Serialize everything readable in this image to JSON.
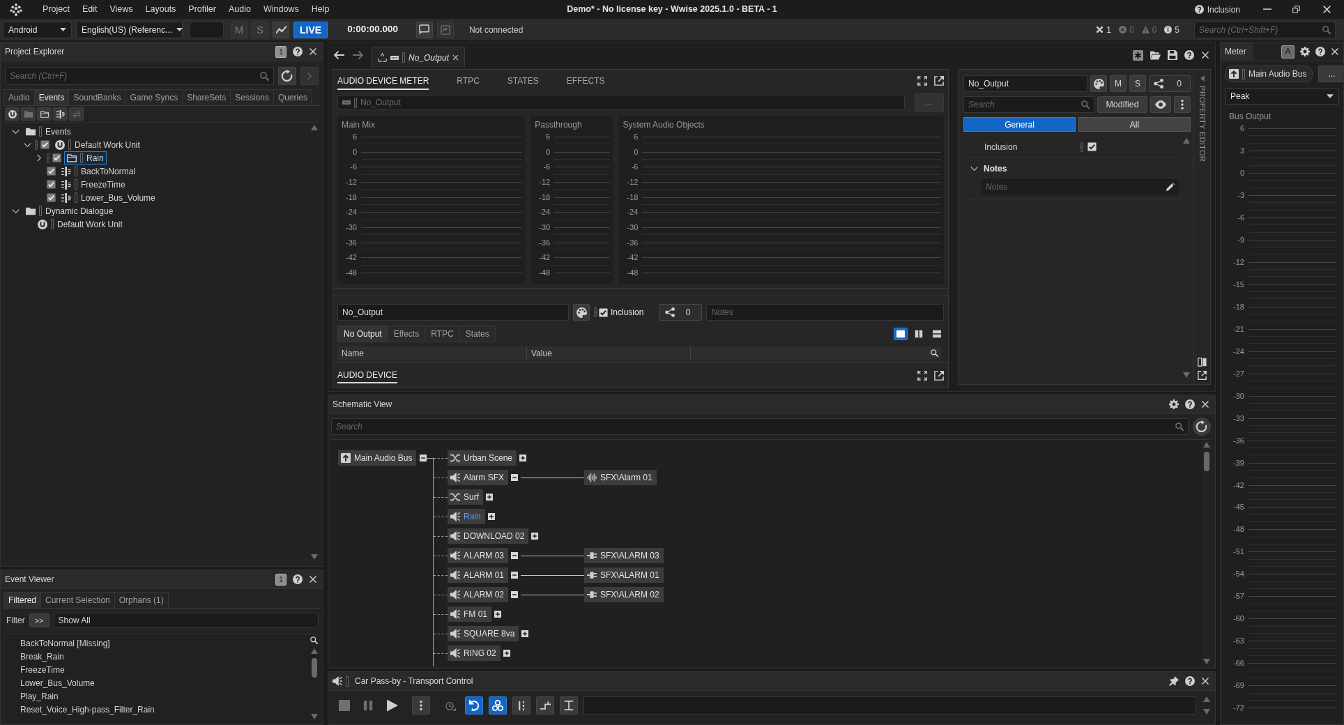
{
  "title_bar": {
    "menu": [
      "Project",
      "Edit",
      "Views",
      "Layouts",
      "Profiler",
      "Audio",
      "Windows",
      "Help"
    ],
    "title": "Demo* - No license key - Wwise 2025.1.0 - BETA - 1",
    "inclusion": "Inclusion"
  },
  "toolbar": {
    "platform": "Android",
    "language": "English(US) (Referenc...",
    "mute": "M",
    "solo": "S",
    "live": {
      "label": "LIVE",
      "on": true
    },
    "time": "0:00:00.000",
    "connection": "Not connected",
    "counters": [
      {
        "kind": "dismiss",
        "value": "1"
      },
      {
        "kind": "error",
        "value": "0"
      },
      {
        "kind": "warning",
        "value": "0"
      },
      {
        "kind": "info",
        "value": "5"
      }
    ],
    "search": {
      "placeholder": "Search (Ctrl+Shift+F)"
    }
  },
  "project_explorer": {
    "title": "Project Explorer",
    "badge": "1",
    "search": {
      "placeholder": "Search (Ctrl+F)"
    },
    "tabs": [
      {
        "label": "Audio",
        "selected": false
      },
      {
        "label": "Events",
        "selected": true
      },
      {
        "label": "SoundBanks",
        "selected": false
      },
      {
        "label": "Game Syncs",
        "selected": false
      },
      {
        "label": "ShareSets",
        "selected": false
      },
      {
        "label": "Sessions",
        "selected": false
      },
      {
        "label": "Queries",
        "selected": false
      }
    ],
    "tree": [
      {
        "label": "Events",
        "kind": "folder",
        "expanded": true,
        "selected": false,
        "children": [
          {
            "label": "Default Work Unit",
            "kind": "work_unit",
            "checked": true,
            "expanded": true,
            "selected": false,
            "children": [
              {
                "label": "Rain",
                "kind": "event_folder",
                "checked": true,
                "expanded": false,
                "selected": true
              },
              {
                "label": "BackToNormal",
                "kind": "event",
                "checked": true,
                "selected": false
              },
              {
                "label": "FreezeTime",
                "kind": "event",
                "checked": true,
                "selected": false
              },
              {
                "label": "Lower_Bus_Volume",
                "kind": "event",
                "checked": true,
                "selected": false
              }
            ]
          }
        ]
      },
      {
        "label": "Dynamic Dialogue",
        "kind": "folder",
        "expanded": true,
        "selected": false,
        "children": [
          {
            "label": "Default Work Unit",
            "kind": "work_unit",
            "selected": false
          }
        ]
      }
    ]
  },
  "event_viewer": {
    "title": "Event Viewer",
    "badge": "1",
    "tabs": [
      {
        "label": "Filtered",
        "selected": true
      },
      {
        "label": "Current Selection",
        "selected": false
      },
      {
        "label": "Orphans (1)",
        "selected": false
      }
    ],
    "filter_label": "Filter",
    "filter_button": ">>",
    "filter_value": "Show All",
    "events": [
      "BackToNormal [Missing]",
      "Break_Rain",
      "FreezeTime",
      "Lower_Bus_Volume",
      "Play_Rain",
      "Reset_Voice_High-pass_Filter_Rain"
    ]
  },
  "editor_tab": {
    "label": "No_Output"
  },
  "audio_device_editor": {
    "tabs": [
      {
        "label": "AUDIO DEVICE METER",
        "selected": true
      },
      {
        "label": "RTPC",
        "selected": false
      },
      {
        "label": "STATES",
        "selected": false
      },
      {
        "label": "EFFECTS",
        "selected": false
      }
    ],
    "device": "No_Output",
    "browse_button": "...",
    "meters": [
      {
        "title": "Main Mix",
        "scale": [
          "6",
          "0",
          "-6",
          "-12",
          "-18",
          "-24",
          "-30",
          "-36",
          "-42",
          "-48"
        ]
      },
      {
        "title": "Passthrough",
        "scale": [
          "6",
          "0",
          "-6",
          "-12",
          "-18",
          "-24",
          "-30",
          "-36",
          "-42",
          "-48"
        ]
      },
      {
        "title": "System Audio Objects",
        "scale": [
          "6",
          "0",
          "-6",
          "-12",
          "-18",
          "-24",
          "-30",
          "-36",
          "-42",
          "-48"
        ]
      }
    ],
    "name": "No_Output",
    "inclusion": {
      "label": "Inclusion",
      "checked": true
    },
    "references": "0",
    "notes": {
      "placeholder": "Notes"
    },
    "subtabs": [
      {
        "label": "No Output",
        "selected": true
      },
      {
        "label": "Effects",
        "selected": false
      },
      {
        "label": "RTPC",
        "selected": false
      },
      {
        "label": "States",
        "selected": false
      }
    ],
    "layouts": [
      {
        "kind": "single",
        "selected": true
      },
      {
        "kind": "columns",
        "selected": false
      },
      {
        "kind": "rows",
        "selected": false
      }
    ],
    "columns": [
      "Name",
      "Value"
    ],
    "section": "AUDIO DEVICE"
  },
  "property_editor": {
    "name": "No_Output",
    "mute": "M",
    "solo": "S",
    "references": "0",
    "search": {
      "placeholder": "Search"
    },
    "filter": "Modified",
    "tabs": [
      {
        "label": "General",
        "selected": true
      },
      {
        "label": "All",
        "selected": false
      }
    ],
    "properties": [
      {
        "label": "Inclusion",
        "checked": true
      }
    ],
    "notes_group": {
      "label": "Notes",
      "expanded": true,
      "placeholder": "Notes"
    },
    "side_label": "PROPERTY EDITOR"
  },
  "schematic_view": {
    "title": "Schematic View",
    "search": {
      "placeholder": "Search"
    },
    "root": {
      "label": "Main Audio Bus",
      "kind": "bus",
      "expanded": true
    },
    "nodes": [
      {
        "label": "Urban Scene",
        "kind": "blend",
        "expanded": false,
        "selected": false
      },
      {
        "label": "Alarm SFX",
        "kind": "sound",
        "expanded": true,
        "selected": false,
        "source": {
          "label": "SFX\\Alarm 01",
          "kind": "wave"
        }
      },
      {
        "label": "Surf",
        "kind": "blend",
        "expanded": false,
        "selected": false
      },
      {
        "label": "Rain",
        "kind": "sound",
        "expanded": false,
        "selected": true
      },
      {
        "label": "DOWNLOAD 02",
        "kind": "sound",
        "expanded": false,
        "selected": false
      },
      {
        "label": "ALARM 03",
        "kind": "sound",
        "expanded": true,
        "selected": false,
        "source": {
          "label": "SFX\\ALARM 03",
          "kind": "plugin"
        }
      },
      {
        "label": "ALARM 01",
        "kind": "sound",
        "expanded": true,
        "selected": false,
        "source": {
          "label": "SFX\\ALARM 01",
          "kind": "plugin"
        }
      },
      {
        "label": "ALARM 02",
        "kind": "sound",
        "expanded": true,
        "selected": false,
        "source": {
          "label": "SFX\\ALARM 02",
          "kind": "plugin"
        }
      },
      {
        "label": "FM 01",
        "kind": "sound",
        "expanded": false,
        "selected": false
      },
      {
        "label": "SQUARE 8va",
        "kind": "sound",
        "expanded": false,
        "selected": false
      },
      {
        "label": "RING 02",
        "kind": "sound",
        "expanded": false,
        "selected": false
      }
    ]
  },
  "transport_control": {
    "title": "Car Pass-by - Transport Control",
    "controls": [
      {
        "kind": "stop",
        "on": false
      },
      {
        "kind": "pause",
        "on": false
      },
      {
        "kind": "play",
        "on": false
      },
      {
        "kind": "more",
        "on": false
      },
      {
        "kind": "history",
        "on": false
      },
      {
        "kind": "loop",
        "on": true
      },
      {
        "kind": "group",
        "on": true
      },
      {
        "kind": "markers",
        "on": false
      },
      {
        "kind": "cue",
        "on": false
      },
      {
        "kind": "text",
        "on": false
      }
    ]
  },
  "meter": {
    "title": "Meter",
    "channel_button": "A",
    "bus": "Main Audio Bus",
    "browse_button": "...",
    "mode": "Peak",
    "label": "Bus Output",
    "scale": [
      "6",
      "3",
      "0",
      "-3",
      "-6",
      "-9",
      "-12",
      "-15",
      "-18",
      "-21",
      "-24",
      "-27",
      "-30",
      "-33",
      "-36",
      "-39",
      "-42",
      "-45",
      "-48",
      "-51",
      "-54",
      "-57",
      "-60",
      "-63",
      "-66",
      "-69",
      "-72"
    ]
  }
}
